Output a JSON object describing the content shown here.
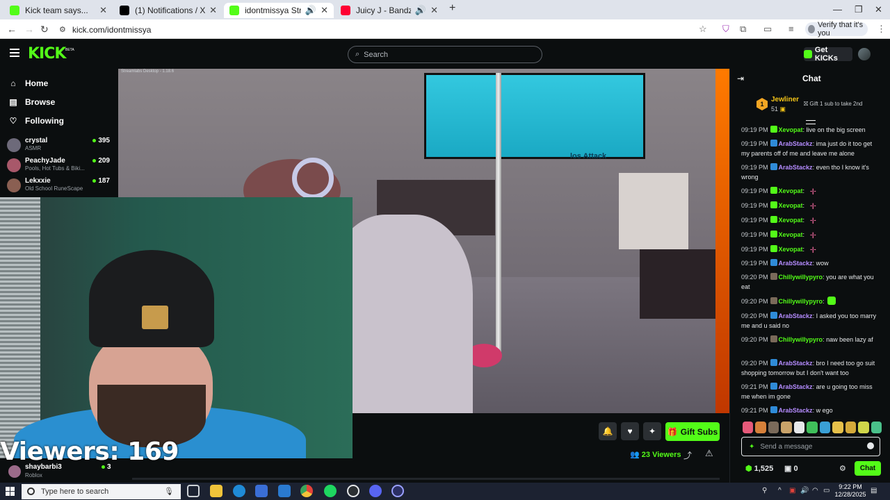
{
  "browser": {
    "tabs": [
      {
        "title": "Kick team says...",
        "active": false,
        "favicon_color": "#53fc18"
      },
      {
        "title": "(1) Notifications / X",
        "active": false,
        "favicon_color": "#000000"
      },
      {
        "title": "idontmissya Stream - Watch",
        "active": true,
        "favicon_color": "#53fc18"
      },
      {
        "title": "Juicy J - Bandz A Make Her",
        "active": false,
        "favicon_color": "#ff0033"
      }
    ],
    "url": "kick.com/idontmissya",
    "verify_label": "Verify that it's you"
  },
  "header": {
    "logo": "KICK",
    "beta": "BETA",
    "search_placeholder": "Search",
    "get_kicks": "Get KICKs"
  },
  "sidebar": {
    "nav": [
      {
        "label": "Home",
        "icon": "home-icon"
      },
      {
        "label": "Browse",
        "icon": "browse-icon"
      },
      {
        "label": "Following",
        "icon": "heart-icon"
      }
    ],
    "channels": [
      {
        "name": "crystal",
        "category": "ASMR",
        "viewers": "395",
        "avatar_color": "#6d6a7a"
      },
      {
        "name": "PeachyJade",
        "category": "Pools, Hot Tubs & Biki...",
        "viewers": "209",
        "avatar_color": "#a8586a"
      },
      {
        "name": "Lekxxie",
        "category": "Old School RuneScape",
        "viewers": "187",
        "avatar_color": "#8a5f52"
      }
    ]
  },
  "video": {
    "streamlabs_title": "Streamlabs Desktop - 1.18.6",
    "tv_text": "los Attack",
    "overlay_viewers": "Viewers: 169"
  },
  "stream_info": {
    "streamer": "shaybarbi3",
    "category": "Roblox",
    "viewers": "3",
    "gift_subs": "Gift Subs",
    "viewer_count": "23",
    "viewer_label": "Viewers"
  },
  "chat": {
    "title": "Chat",
    "pinned": {
      "rank": "1",
      "name": "Jewliner",
      "amount": "51",
      "gift_text": "Gift 1 sub to take 2nd"
    },
    "messages": [
      {
        "time": "09:19 PM",
        "user": "Xevopat",
        "color": "#53fc18",
        "badge": "#53fc18",
        "text": " live on the big screen"
      },
      {
        "time": "09:19 PM",
        "user": "ArabStackz",
        "color": "#b58cff",
        "badge": "#2f8bd8",
        "text": " ima just do it too get my parents off of me and leave me alone"
      },
      {
        "time": "09:19 PM",
        "user": "ArabStackz",
        "color": "#b58cff",
        "badge": "#2f8bd8",
        "text": " even tho I know it's wrong"
      },
      {
        "time": "09:19 PM",
        "user": "Xevopat",
        "color": "#53fc18",
        "badge": "#53fc18",
        "text": "",
        "ascii": "-|-"
      },
      {
        "time": "09:19 PM",
        "user": "Xevopat",
        "color": "#53fc18",
        "badge": "#53fc18",
        "text": "",
        "ascii": "-|-"
      },
      {
        "time": "09:19 PM",
        "user": "Xevopat",
        "color": "#53fc18",
        "badge": "#53fc18",
        "text": "",
        "ascii": "-|-"
      },
      {
        "time": "09:19 PM",
        "user": "Xevopat",
        "color": "#53fc18",
        "badge": "#53fc18",
        "text": "",
        "ascii": "-|-"
      },
      {
        "time": "09:19 PM",
        "user": "Xevopat",
        "color": "#53fc18",
        "badge": "#53fc18",
        "text": "",
        "ascii": "-|-"
      },
      {
        "time": "09:19 PM",
        "user": "ArabStackz",
        "color": "#b58cff",
        "badge": "#2f8bd8",
        "text": " wow"
      },
      {
        "time": "09:20 PM",
        "user": "Chillywillypyro",
        "color": "#53fc18",
        "badge": "#7a6a5a",
        "text": " you are what you eat"
      },
      {
        "time": "09:20 PM",
        "user": "Chillywillypyro",
        "color": "#53fc18",
        "badge": "#7a6a5a",
        "text": "",
        "emote": true
      },
      {
        "time": "09:20 PM",
        "user": "ArabStackz",
        "color": "#b58cff",
        "badge": "#2f8bd8",
        "text": " I asked you too marry me and u said no"
      },
      {
        "time": "09:20 PM",
        "user": "Chillywillypyro",
        "color": "#53fc18",
        "badge": "#7a6a5a",
        "text": " naw been lazy af"
      },
      {
        "time": "09:20 PM",
        "user": "ArabStackz",
        "color": "#b58cff",
        "badge": "#2f8bd8",
        "text": " bro I need too go suit shopping tomorrow but I don't want too"
      },
      {
        "time": "09:21 PM",
        "user": "ArabStackz",
        "color": "#b58cff",
        "badge": "#2f8bd8",
        "text": " are u going too miss me when im gone"
      },
      {
        "time": "09:21 PM",
        "user": "ArabStackz",
        "color": "#b58cff",
        "badge": "#2f8bd8",
        "text": " w ego"
      }
    ],
    "input_placeholder": "Send a message",
    "kicks": "1,525",
    "chest": "0",
    "send_label": "Chat"
  },
  "taskbar": {
    "search_placeholder": "Type here to search",
    "time": "9:22 PM",
    "date": "12/28/2025"
  }
}
